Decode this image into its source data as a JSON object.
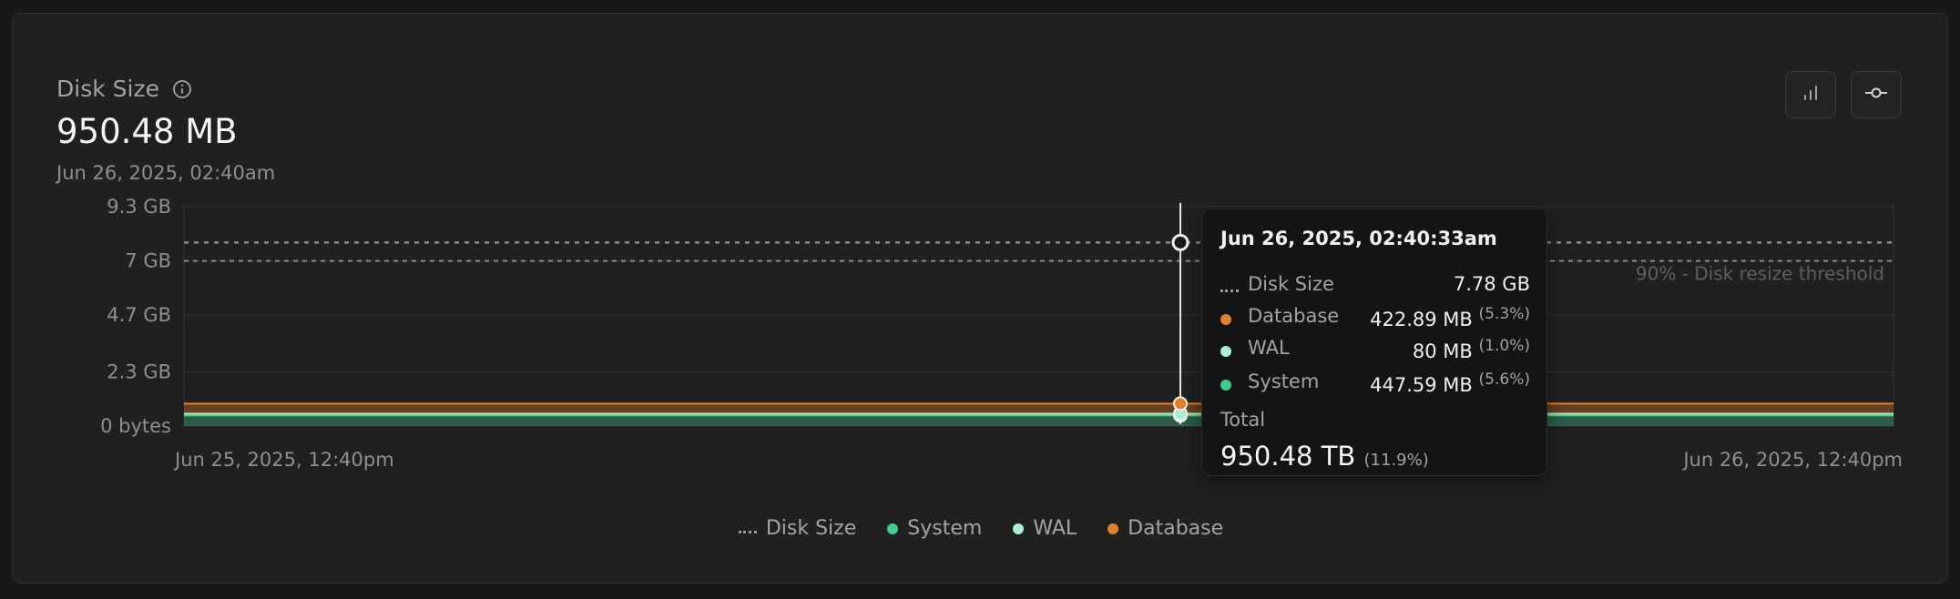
{
  "header": {
    "title": "Disk Size",
    "value": "950.48 MB",
    "date": "Jun 26, 2025, 02:40am"
  },
  "toolbar": {
    "bar_icon": "bar-chart-icon",
    "line_icon": "commit-line-icon"
  },
  "colors": {
    "database": "#e47f2b",
    "wal": "#a8f0cf",
    "system": "#3ecf8e",
    "disk_size": "#9a9a9a"
  },
  "chart_data": {
    "type": "area",
    "title": "Disk Size",
    "y_ticks": [
      "9.3 GB",
      "7 GB",
      "4.7 GB",
      "2.3 GB",
      "0 bytes"
    ],
    "y_tick_values_gb": [
      9.3,
      7.0,
      4.7,
      2.3,
      0
    ],
    "ylim_gb": [
      0,
      9.3
    ],
    "x_tick_labels": [
      "Jun 25, 2025, 12:40pm",
      "Jun 26, 2025, 12:40pm"
    ],
    "threshold_label": "90% - Disk resize threshold",
    "threshold_gb": 7.0,
    "disk_size_gb": 7.78,
    "series": [
      {
        "name": "System",
        "value_gb": 0.44759,
        "color": "#3ecf8e"
      },
      {
        "name": "WAL",
        "value_gb": 0.08,
        "color": "#a8f0cf"
      },
      {
        "name": "Database",
        "value_gb": 0.42289,
        "color": "#e47f2b"
      }
    ],
    "grid": true,
    "legend": "bottom"
  },
  "tooltip": {
    "date": "Jun 26, 2025, 02:40:33am",
    "rows": [
      {
        "label": "Disk Size",
        "value": "7.78 GB",
        "pct": ""
      },
      {
        "label": "Database",
        "value": "422.89 MB",
        "pct": "(5.3%)"
      },
      {
        "label": "WAL",
        "value": "80 MB",
        "pct": "(1.0%)"
      },
      {
        "label": "System",
        "value": "447.59 MB",
        "pct": "(5.6%)"
      }
    ],
    "total_label": "Total",
    "total_value": "950.48 TB",
    "total_pct": "(11.9%)"
  },
  "legend": [
    {
      "label": "Disk Size",
      "marker": "dotted-line"
    },
    {
      "label": "System",
      "marker": "dot"
    },
    {
      "label": "WAL",
      "marker": "dot"
    },
    {
      "label": "Database",
      "marker": "dot"
    }
  ]
}
